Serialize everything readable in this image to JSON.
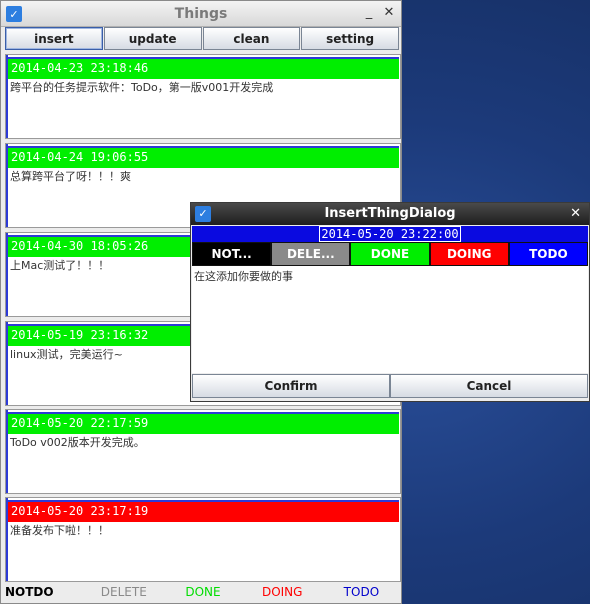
{
  "main_window": {
    "title": "Things",
    "icon": "app-check-icon",
    "controls": {
      "minimize": "_",
      "close": "✕"
    }
  },
  "toolbar": {
    "buttons": [
      {
        "label": "insert"
      },
      {
        "label": "update"
      },
      {
        "label": "clean"
      },
      {
        "label": "setting"
      }
    ]
  },
  "things": [
    {
      "timestamp": "2014-04-23 23:18:46",
      "text": "跨平台的任务提示软件：ToDo，第一版v001开发完成",
      "status": "DONE",
      "color": "#00ee00"
    },
    {
      "timestamp": "2014-04-24 19:06:55",
      "text": "总算跨平台了呀！！！爽",
      "status": "DONE",
      "color": "#00ee00"
    },
    {
      "timestamp": "2014-04-30 18:05:26",
      "text": "上Mac测试了！！！",
      "status": "DONE",
      "color": "#00ee00"
    },
    {
      "timestamp": "2014-05-19 23:16:32",
      "text": "linux测试，完美运行~",
      "status": "DONE",
      "color": "#00ee00"
    },
    {
      "timestamp": "2014-05-20 22:17:59",
      "text": "ToDo v002版本开发完成。",
      "status": "DONE",
      "color": "#00ee00"
    },
    {
      "timestamp": "2014-05-20 23:17:19",
      "text": "准备发布下啦！！！",
      "status": "DOING",
      "color": "#ff0000"
    }
  ],
  "legend": [
    {
      "label": "NOTDO",
      "color": "#000000"
    },
    {
      "label": "DELETE",
      "color": "#8a8a8a"
    },
    {
      "label": "DONE",
      "color": "#00dd00"
    },
    {
      "label": "DOING",
      "color": "#ff0000"
    },
    {
      "label": "TODO",
      "color": "#0000cc"
    }
  ],
  "dialog": {
    "title": "InsertThingDialog",
    "icon": "app-check-icon",
    "close": "✕",
    "datetime": "2014-05-20 23:22:00",
    "statuses": [
      {
        "label": "NOT...",
        "color": "#000000"
      },
      {
        "label": "DELE...",
        "color": "#8a8a8a"
      },
      {
        "label": "DONE",
        "color": "#00ee00"
      },
      {
        "label": "DOING",
        "color": "#ff0000"
      },
      {
        "label": "TODO",
        "color": "#0000ff"
      }
    ],
    "content_placeholder": "在这添加你要做的事",
    "confirm_label": "Confirm",
    "cancel_label": "Cancel"
  }
}
